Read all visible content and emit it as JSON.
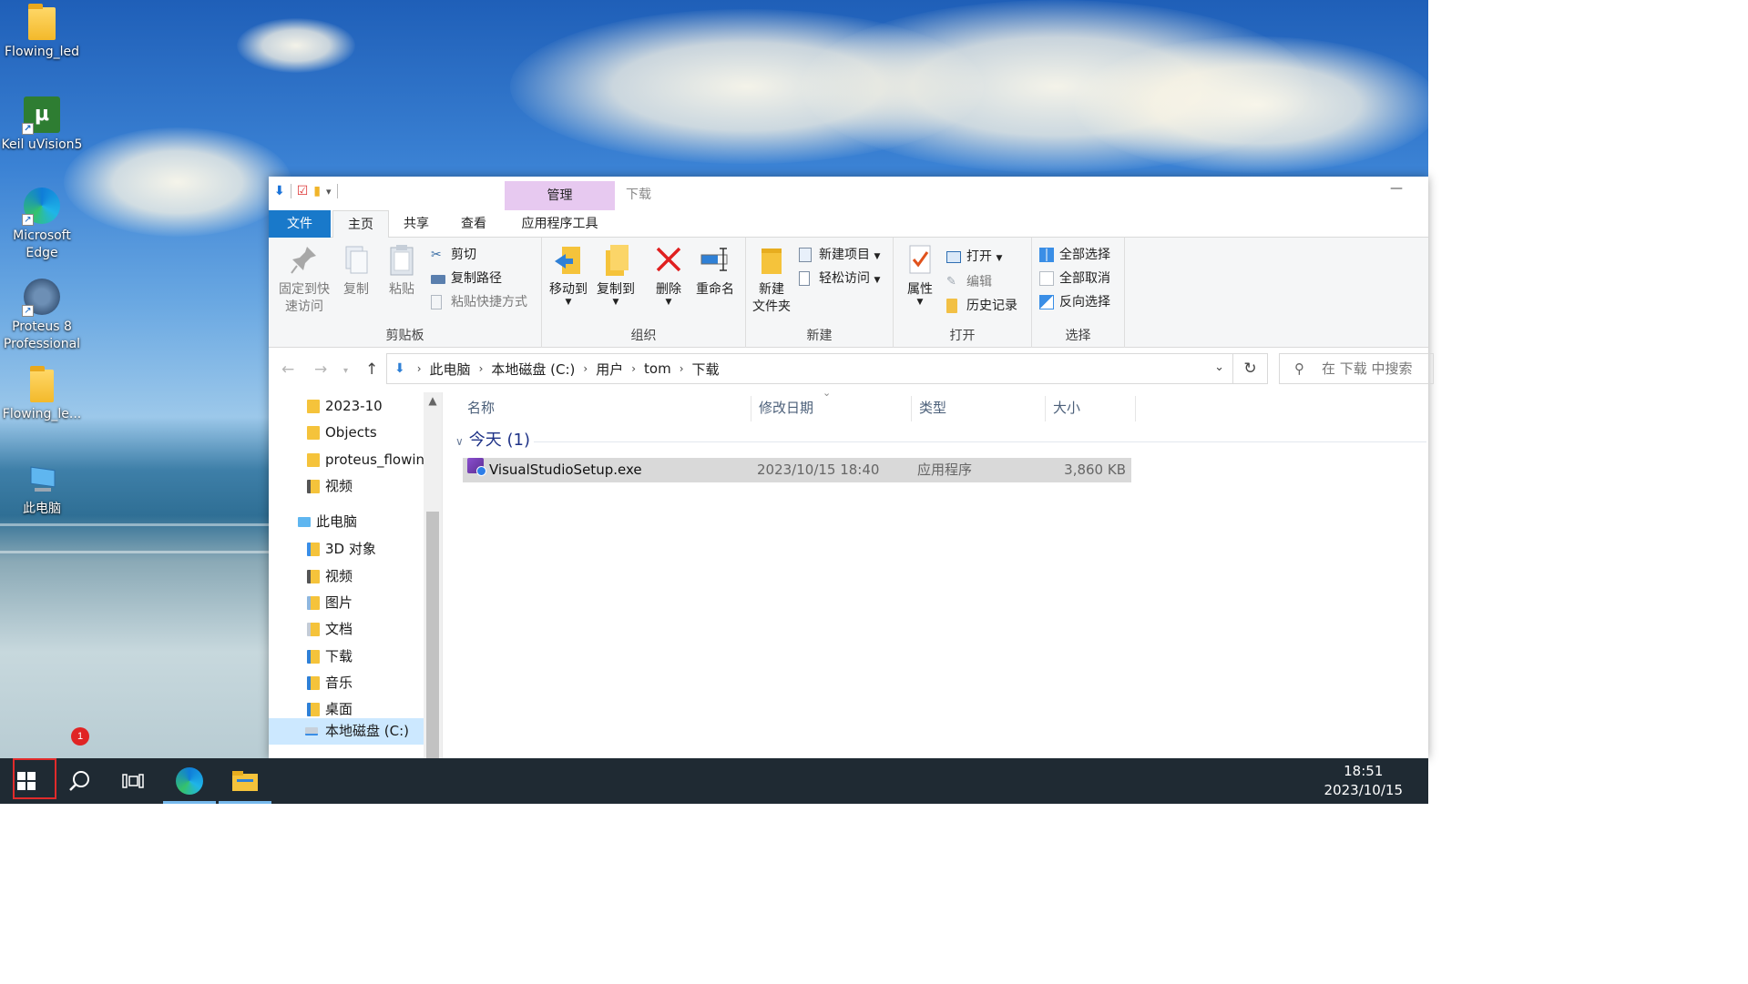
{
  "desktop": {
    "icons": [
      {
        "label": "Flowing_led"
      },
      {
        "label": "Keil uVision5"
      },
      {
        "label": "Microsoft Edge"
      },
      {
        "label": "Proteus 8 Professional"
      },
      {
        "label": "Flowing_le..."
      },
      {
        "label": "此电脑"
      }
    ],
    "notification_badge": "1"
  },
  "explorer": {
    "window_title": "下载",
    "context_tab_label": "管理",
    "minimize_glyph": "—",
    "tabs": {
      "file": "文件",
      "home": "主页",
      "share": "共享",
      "view": "查看",
      "app_tools": "应用程序工具"
    },
    "ribbon": {
      "clipboard": {
        "label": "剪贴板",
        "pin_line1": "固定到快",
        "pin_line2": "速访问",
        "copy": "复制",
        "paste": "粘贴",
        "cut": "剪切",
        "copy_path": "复制路径",
        "paste_shortcut": "粘贴快捷方式"
      },
      "organize": {
        "label": "组织",
        "move_to": "移动到",
        "copy_to": "复制到",
        "delete": "删除",
        "rename": "重命名"
      },
      "new": {
        "label": "新建",
        "new_folder_line1": "新建",
        "new_folder_line2": "文件夹",
        "new_item": "新建项目",
        "easy_access": "轻松访问"
      },
      "open": {
        "label": "打开",
        "properties": "属性",
        "open": "打开",
        "edit": "编辑",
        "history": "历史记录"
      },
      "select": {
        "label": "选择",
        "select_all": "全部选择",
        "select_none": "全部取消",
        "invert": "反向选择"
      }
    },
    "address": {
      "crumbs": [
        "此电脑",
        "本地磁盘 (C:)",
        "用户",
        "tom",
        "下载"
      ],
      "search_placeholder": "在 下载 中搜索"
    },
    "nav_pane": {
      "items": [
        {
          "label": "2023-10"
        },
        {
          "label": "Objects"
        },
        {
          "label": "proteus_flowing"
        },
        {
          "label": "视频"
        },
        {
          "label": "此电脑"
        },
        {
          "label": "3D 对象"
        },
        {
          "label": "视频"
        },
        {
          "label": "图片"
        },
        {
          "label": "文档"
        },
        {
          "label": "下载"
        },
        {
          "label": "音乐"
        },
        {
          "label": "桌面"
        },
        {
          "label": "本地磁盘 (C:)"
        }
      ]
    },
    "file_list": {
      "columns": {
        "name": "名称",
        "modified": "修改日期",
        "type": "类型",
        "size": "大小"
      },
      "group_header": "今天 (1)",
      "rows": [
        {
          "name": "VisualStudioSetup.exe",
          "modified": "2023/10/15 18:40",
          "type": "应用程序",
          "size": "3,860 KB"
        }
      ]
    }
  },
  "taskbar": {
    "time": "18:51",
    "date": "2023/10/15"
  }
}
